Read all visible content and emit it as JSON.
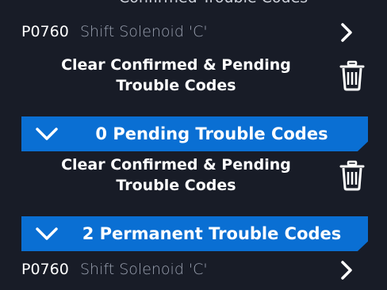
{
  "top_cut": {
    "text": "Confirmed Trouble Codes"
  },
  "codes_confirmed": [
    {
      "code": "P0760",
      "description": "Shift Solenoid 'C'"
    }
  ],
  "clear_action_1": {
    "label_line1": "Clear Confirmed & Pending",
    "label_line2": "Trouble Codes"
  },
  "pending_section": {
    "title": "0 Pending Trouble Codes"
  },
  "clear_action_2": {
    "label_line1": "Clear Confirmed & Pending",
    "label_line2": "Trouble Codes"
  },
  "permanent_section": {
    "title": "2 Permanent Trouble Codes"
  },
  "codes_permanent": [
    {
      "code": "P0760",
      "description": "Shift Solenoid 'C'"
    }
  ],
  "colors": {
    "background": "#181c27",
    "section_header": "#0a6fd3",
    "text_primary": "#ffffff",
    "text_secondary": "#9aa1b0"
  },
  "icons": {
    "row_chevron": "chevron-right-icon",
    "section_chevron": "chevron-down-icon",
    "clear": "trash-icon"
  }
}
